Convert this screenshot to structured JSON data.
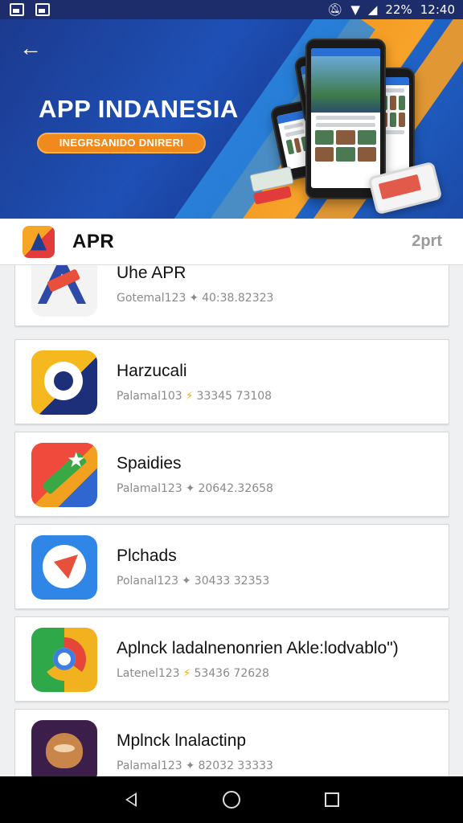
{
  "status_bar": {
    "battery": "22%",
    "time": "12:40",
    "icons": [
      "image-icon",
      "gallery-icon",
      "mute-icon",
      "wifi-icon",
      "signal-icon"
    ]
  },
  "banner": {
    "title": "APP INDANESIA",
    "subtitle": "INEGRSANIDO DNIRERI",
    "back_icon": "back-arrow-icon"
  },
  "app_bar": {
    "title": "APR",
    "right_label": "2prt",
    "logo_icon": "app-logo-icon"
  },
  "apps": [
    {
      "name": "Uhe APR",
      "meta_left": "Gotemal123",
      "meta_star": "✦",
      "meta_right": "40:38.82323",
      "icon": "arrow-a-logo-icon"
    },
    {
      "name": "Harzucali",
      "meta_left": "Palamal103",
      "meta_star": "⚡",
      "meta_right": "33345 73108",
      "icon": "ring-logo-icon"
    },
    {
      "name": "Spaidies",
      "meta_left": "Palamal123",
      "meta_star": "✦",
      "meta_right": "20642.32658",
      "icon": "star-stripe-logo-icon"
    },
    {
      "name": "Plchads",
      "meta_left": "Polanal123",
      "meta_star": "✦",
      "meta_right": "30433 32353",
      "icon": "paper-plane-logo-icon"
    },
    {
      "name": "Aplnck ladalnenonrien Akle:lodvablo\")",
      "meta_left": "Latenel123",
      "meta_star": "⚡",
      "meta_right": "53436 72628",
      "icon": "chrome-like-logo-icon"
    },
    {
      "name": "Mplnck lnalactinp",
      "meta_left": "Palamal123",
      "meta_star": "✦",
      "meta_right": "82032 33333",
      "icon": "fox-mascot-logo-icon"
    }
  ],
  "nav_bar": {
    "buttons": [
      "nav-back-icon",
      "nav-home-icon",
      "nav-recents-icon"
    ]
  }
}
